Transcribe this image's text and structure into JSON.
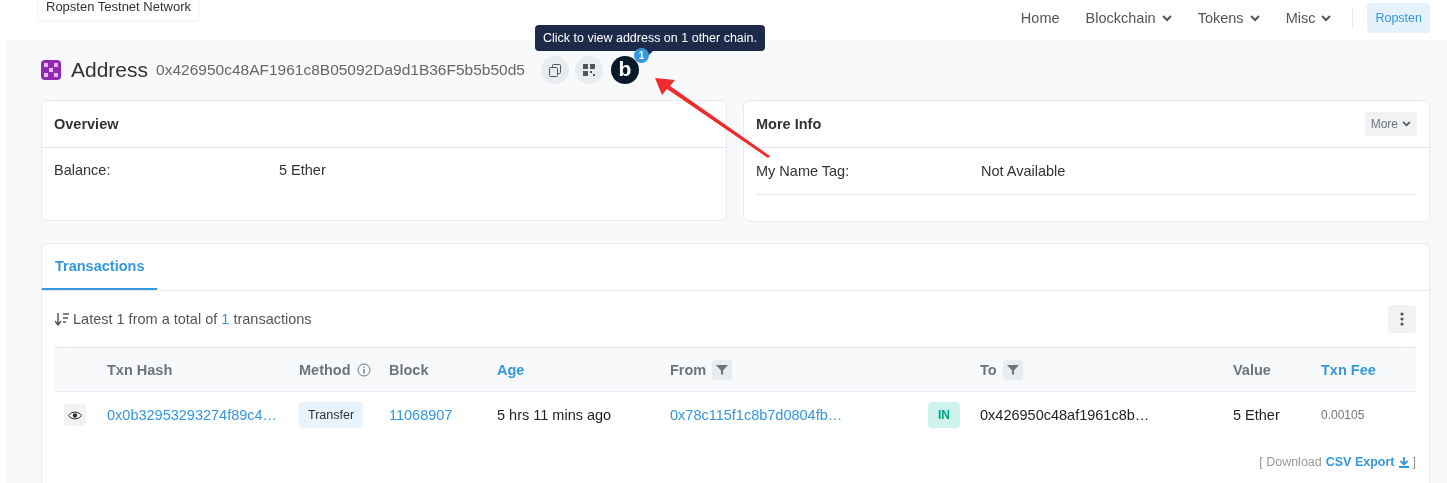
{
  "network_badge": "Ropsten Testnet Network",
  "nav": {
    "items": [
      {
        "label": "Home",
        "dropdown": false
      },
      {
        "label": "Blockchain",
        "dropdown": true
      },
      {
        "label": "Tokens",
        "dropdown": true
      },
      {
        "label": "Misc",
        "dropdown": true
      }
    ],
    "network_button": "Ropsten"
  },
  "tooltip": "Click to view address on 1 other chain.",
  "address": {
    "title": "Address",
    "value": "0x426950c48AF1961c8B05092Da9d1B36F5b5b50d5",
    "chain_letter": "b",
    "chain_count": "1"
  },
  "overview": {
    "title": "Overview",
    "rows": [
      {
        "label": "Balance:",
        "value": "5 Ether"
      }
    ]
  },
  "more_info": {
    "title": "More Info",
    "more_button": "More",
    "rows": [
      {
        "label": "My Name Tag:",
        "value": "Not Available"
      }
    ]
  },
  "transactions": {
    "tabs": [
      {
        "label": "Transactions",
        "selected": true
      }
    ],
    "summary": {
      "start": "Latest 1 from a total of",
      "count": "1",
      "end": "transactions"
    },
    "columns": [
      {
        "label": "Txn Hash",
        "kind": "plain"
      },
      {
        "label": "Method",
        "kind": "info"
      },
      {
        "label": "Block",
        "kind": "plain"
      },
      {
        "label": "Age",
        "kind": "link"
      },
      {
        "label": "From",
        "kind": "filter"
      },
      {
        "label": "To",
        "kind": "filter"
      },
      {
        "label": "Value",
        "kind": "plain"
      },
      {
        "label": "Txn Fee",
        "kind": "link"
      }
    ],
    "rows": [
      {
        "hash": "0x0b32953293274f89c4…",
        "method": "Transfer",
        "block": "11068907",
        "age": "5 hrs 11 mins ago",
        "from": "0x78c115f1c8b7d0804fb…",
        "direction": "IN",
        "to": "0x426950c48af1961c8b…",
        "value": "5 Ether",
        "fee": "0.00105"
      }
    ],
    "download": {
      "start": "[ Download",
      "link": "CSV Export",
      "end": "]"
    }
  }
}
